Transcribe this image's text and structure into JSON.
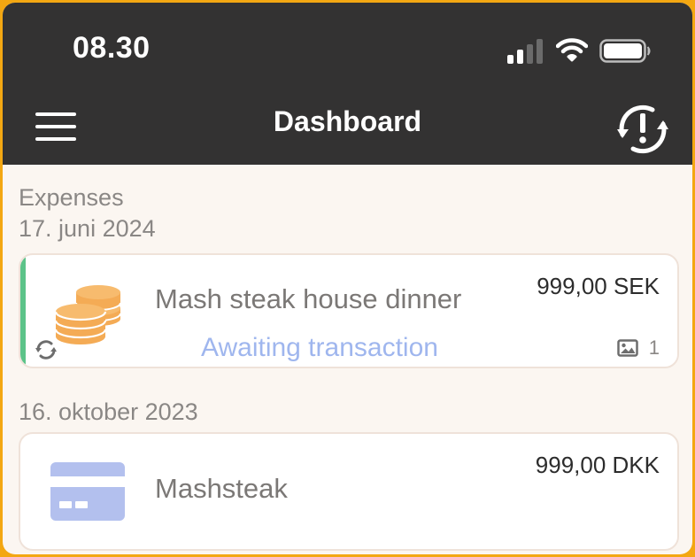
{
  "status_bar": {
    "time": "08.30"
  },
  "header": {
    "title": "Dashboard"
  },
  "colors": {
    "header_bg": "#333232",
    "page_bg": "#fbf6f1",
    "accent_green": "#5cc389",
    "awaiting_blue": "#9fb6ee",
    "coin_orange": "#f4ab55",
    "card_icon_blue": "#b3c0ee"
  },
  "sections": [
    {
      "label": "Expenses",
      "date": "17. juni 2024",
      "items": [
        {
          "title": "Mash steak house dinner",
          "amount": "999,00 SEK",
          "status": "Awaiting transaction",
          "attachments": "1",
          "icon": "coins-icon",
          "sync_icon": "sync-icon"
        }
      ]
    },
    {
      "date": "16. oktober 2023",
      "items": [
        {
          "title": "Mashsteak",
          "amount": "999,00 DKK",
          "icon": "credit-card-icon"
        }
      ]
    }
  ]
}
